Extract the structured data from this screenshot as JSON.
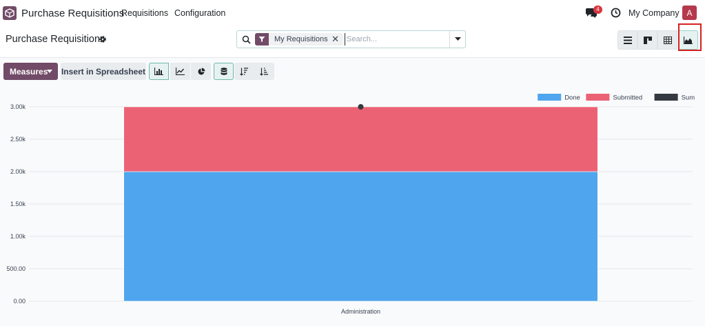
{
  "navbar": {
    "app_name": "Purchase Requisitions",
    "menus": [
      "Requisitions",
      "Configuration"
    ],
    "message_count": "4",
    "company": "My Company",
    "avatar_letter": "A"
  },
  "control_panel": {
    "title": "Purchase Requisitions",
    "search": {
      "facet_label": "My Requisitions",
      "placeholder": "Search..."
    },
    "views": [
      {
        "icon": "list-view-icon",
        "active": false
      },
      {
        "icon": "kanban-view-icon",
        "active": false
      },
      {
        "icon": "pivot-view-icon",
        "active": false
      },
      {
        "icon": "graph-view-icon",
        "active": true
      }
    ]
  },
  "toolbar": {
    "measures_label": "Measures",
    "spreadsheet_label": "Insert in Spreadsheet",
    "chart_types": [
      {
        "icon": "bar-chart-icon",
        "active": true
      },
      {
        "icon": "line-chart-icon",
        "active": false
      },
      {
        "icon": "pie-chart-icon",
        "active": false
      }
    ],
    "stacked_active": true,
    "sort_buttons": [
      "sort-descending-icon",
      "sort-ascending-icon"
    ]
  },
  "colors": {
    "primary": "#714B67",
    "done": "#4fa5ee",
    "submitted": "#ec6275",
    "sum": "#343a40"
  },
  "chart_data": {
    "type": "bar",
    "stacked": true,
    "categories": [
      "Administration"
    ],
    "series": [
      {
        "name": "Done",
        "values": [
          2000
        ],
        "color": "#4fa5ee"
      },
      {
        "name": "Submitted",
        "values": [
          1000
        ],
        "color": "#ec6275"
      },
      {
        "name": "Sum",
        "values": [
          3000
        ],
        "color": "#343a40",
        "style": "point"
      }
    ],
    "ylim": [
      0,
      3000
    ],
    "yticks": [
      0,
      500,
      1000,
      1500,
      2000,
      2500,
      3000
    ],
    "ytick_labels": [
      "0.00",
      "500.00",
      "1.00k",
      "1.50k",
      "2.00k",
      "2.50k",
      "3.00k"
    ],
    "grid": true,
    "legend": "top-right"
  }
}
